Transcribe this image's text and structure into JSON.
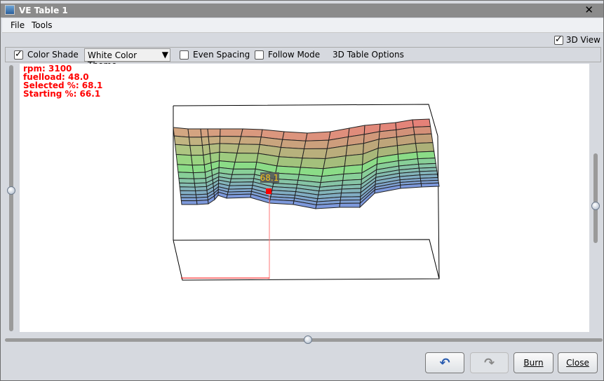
{
  "window": {
    "title": "VE Table 1"
  },
  "menu": [
    "File",
    "Tools"
  ],
  "view3d": {
    "label": "3D View",
    "checked": true
  },
  "toolbar": {
    "color_shade": "Color Shade",
    "color_shade_checked": true,
    "theme": "White Color Theme",
    "even_spacing": "Even Spacing",
    "follow_mode": "Follow Mode",
    "options": "3D Table Options"
  },
  "info": {
    "rpm": "rpm: 3100",
    "fuelload": "fuelload: 48.0",
    "selected": "Selected %: 68.1",
    "starting": "Starting %: 66.1"
  },
  "cursor": {
    "value": "68.1",
    "color": "#ff0000"
  },
  "buttons": {
    "undo": "undo",
    "redo": "redo",
    "burn": "Burn",
    "close": "Close"
  }
}
